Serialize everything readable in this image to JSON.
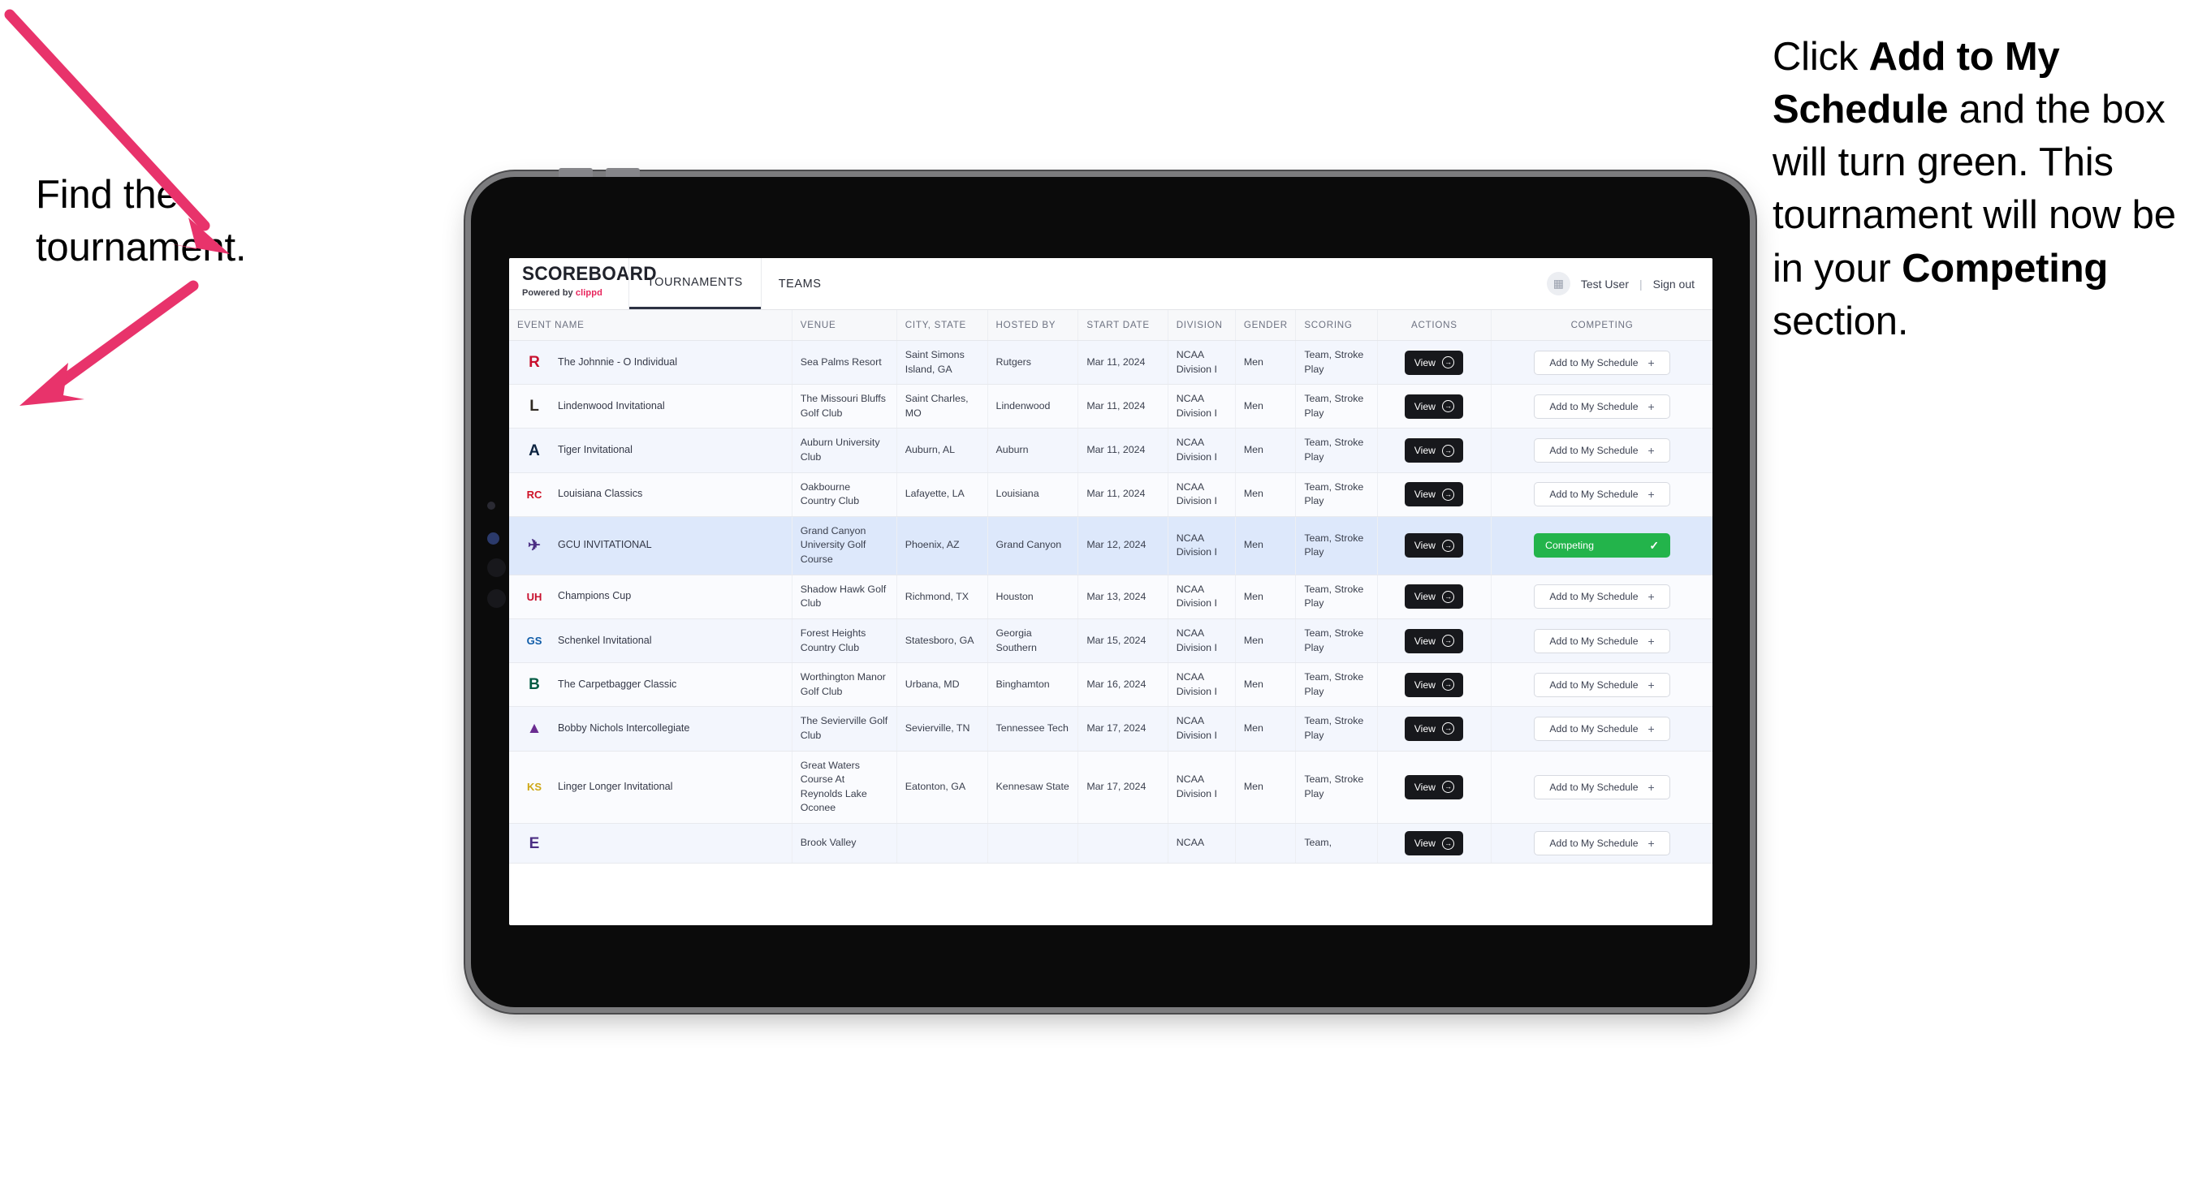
{
  "annotations": {
    "left": "Find the tournament.",
    "right_parts": [
      {
        "text": "Click ",
        "bold": false
      },
      {
        "text": "Add to My Schedule",
        "bold": true
      },
      {
        "text": " and the box will turn green. This tournament will now be in your ",
        "bold": false
      },
      {
        "text": "Competing",
        "bold": true
      },
      {
        "text": " section.",
        "bold": false
      }
    ],
    "arrow_color": "#E8336B"
  },
  "app": {
    "brand": {
      "title": "SCOREBOARD",
      "powered_prefix": "Powered by ",
      "powered_name": "clippd"
    },
    "nav": {
      "tabs": [
        {
          "label": "TOURNAMENTS",
          "active": true
        },
        {
          "label": "TEAMS",
          "active": false
        }
      ]
    },
    "user": {
      "avatar_icon": "user-badge-icon",
      "name": "Test User",
      "separator": "|",
      "signout": "Sign out"
    },
    "table": {
      "columns": [
        "EVENT NAME",
        "VENUE",
        "CITY, STATE",
        "HOSTED BY",
        "START DATE",
        "DIVISION",
        "GENDER",
        "SCORING",
        "ACTIONS",
        "COMPETING"
      ],
      "view_label": "View",
      "view_icon": "arrow-right-circle-icon",
      "add_label": "Add to My Schedule",
      "add_icon": "plus-icon",
      "competing_label": "Competing",
      "competing_icon": "check-icon",
      "competing_color": "#23b44b",
      "rows": [
        {
          "logo_text": "R",
          "logo_color": "#C8102E",
          "logo_bg": "transparent",
          "event": "The Johnnie - O Individual",
          "venue": "Sea Palms Resort",
          "city": "Saint Simons Island, GA",
          "hosted_by": "Rutgers",
          "start_date": "Mar 11, 2024",
          "division": "NCAA Division I",
          "gender": "Men",
          "scoring": "Team, Stroke Play",
          "competing": false
        },
        {
          "logo_text": "L",
          "logo_color": "#2f2a22",
          "logo_bg": "transparent",
          "event": "Lindenwood Invitational",
          "venue": "The Missouri Bluffs Golf Club",
          "city": "Saint Charles, MO",
          "hosted_by": "Lindenwood",
          "start_date": "Mar 11, 2024",
          "division": "NCAA Division I",
          "gender": "Men",
          "scoring": "Team, Stroke Play",
          "competing": false
        },
        {
          "logo_text": "A",
          "logo_color": "#0C2340",
          "logo_bg": "transparent",
          "event": "Tiger Invitational",
          "venue": "Auburn University Club",
          "city": "Auburn, AL",
          "hosted_by": "Auburn",
          "start_date": "Mar 11, 2024",
          "division": "NCAA Division I",
          "gender": "Men",
          "scoring": "Team, Stroke Play",
          "competing": false
        },
        {
          "logo_text": "RC",
          "logo_color": "#CE1126",
          "logo_bg": "transparent",
          "event": "Louisiana Classics",
          "venue": "Oakbourne Country Club",
          "city": "Lafayette, LA",
          "hosted_by": "Louisiana",
          "start_date": "Mar 11, 2024",
          "division": "NCAA Division I",
          "gender": "Men",
          "scoring": "Team, Stroke Play",
          "competing": false
        },
        {
          "logo_text": "✈",
          "logo_color": "#4B2E83",
          "logo_bg": "transparent",
          "event": "GCU INVITATIONAL",
          "venue": "Grand Canyon University Golf Course",
          "city": "Phoenix, AZ",
          "hosted_by": "Grand Canyon",
          "start_date": "Mar 12, 2024",
          "division": "NCAA Division I",
          "gender": "Men",
          "scoring": "Team, Stroke Play",
          "competing": true,
          "selected": true
        },
        {
          "logo_text": "UH",
          "logo_color": "#C8102E",
          "logo_bg": "transparent",
          "event": "Champions Cup",
          "venue": "Shadow Hawk Golf Club",
          "city": "Richmond, TX",
          "hosted_by": "Houston",
          "start_date": "Mar 13, 2024",
          "division": "NCAA Division I",
          "gender": "Men",
          "scoring": "Team, Stroke Play",
          "competing": false
        },
        {
          "logo_text": "GS",
          "logo_color": "#0F5CA8",
          "logo_bg": "transparent",
          "event": "Schenkel Invitational",
          "venue": "Forest Heights Country Club",
          "city": "Statesboro, GA",
          "hosted_by": "Georgia Southern",
          "start_date": "Mar 15, 2024",
          "division": "NCAA Division I",
          "gender": "Men",
          "scoring": "Team, Stroke Play",
          "competing": false
        },
        {
          "logo_text": "B",
          "logo_color": "#005A43",
          "logo_bg": "transparent",
          "event": "The Carpetbagger Classic",
          "venue": "Worthington Manor Golf Club",
          "city": "Urbana, MD",
          "hosted_by": "Binghamton",
          "start_date": "Mar 16, 2024",
          "division": "NCAA Division I",
          "gender": "Men",
          "scoring": "Team, Stroke Play",
          "competing": false
        },
        {
          "logo_text": "▲",
          "logo_color": "#6A2C91",
          "logo_bg": "transparent",
          "event": "Bobby Nichols Intercollegiate",
          "venue": "The Sevierville Golf Club",
          "city": "Sevierville, TN",
          "hosted_by": "Tennessee Tech",
          "start_date": "Mar 17, 2024",
          "division": "NCAA Division I",
          "gender": "Men",
          "scoring": "Team, Stroke Play",
          "competing": false
        },
        {
          "logo_text": "KS",
          "logo_color": "#CEA715",
          "logo_bg": "transparent",
          "event": "Linger Longer Invitational",
          "venue": "Great Waters Course At Reynolds Lake Oconee",
          "city": "Eatonton, GA",
          "hosted_by": "Kennesaw State",
          "start_date": "Mar 17, 2024",
          "division": "NCAA Division I",
          "gender": "Men",
          "scoring": "Team, Stroke Play",
          "competing": false
        },
        {
          "logo_text": "E",
          "logo_color": "#4B2E83",
          "logo_bg": "transparent",
          "event": "",
          "venue": "Brook Valley",
          "city": "",
          "hosted_by": "",
          "start_date": "",
          "division": "NCAA",
          "gender": "",
          "scoring": "Team,",
          "competing": false,
          "partial": true
        }
      ]
    }
  }
}
